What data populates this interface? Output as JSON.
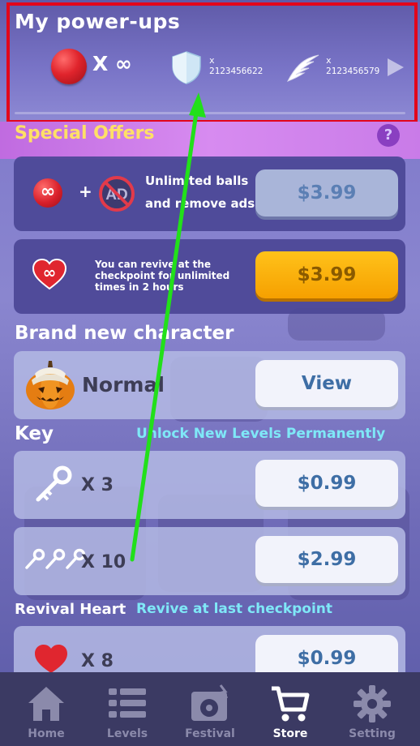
{
  "powerups": {
    "title": "My power-ups",
    "ball_count": "X ∞",
    "shield_x": "x",
    "shield_count": "2123456622",
    "wing_x": "x",
    "wing_count": "2123456579"
  },
  "offers": {
    "title": "Special Offers",
    "help": "?",
    "plus": "+",
    "bundle_text_1": "Unlimited balls",
    "bundle_text_2": "and remove ads",
    "bundle_price": "$3.99",
    "revive_text_1": "You can revive at the",
    "revive_text_2": "checkpoint for unlimited",
    "revive_text_3": "times in 2 hours",
    "revive_price": "$3.99"
  },
  "character": {
    "title": "Brand new character",
    "name": "Normal",
    "button": "View"
  },
  "key": {
    "title": "Key",
    "subtitle": "Unlock New Levels Permanently",
    "items": [
      {
        "qty": "X 3",
        "price": "$0.99"
      },
      {
        "qty": "X 10",
        "price": "$2.99"
      }
    ]
  },
  "revival": {
    "title": "Revival Heart",
    "subtitle": "Revive at last checkpoint",
    "items": [
      {
        "qty": "X 8",
        "price": "$0.99"
      }
    ]
  },
  "tabs": [
    {
      "label": "Home",
      "icon": "home-icon"
    },
    {
      "label": "Levels",
      "icon": "list-icon"
    },
    {
      "label": "Festival",
      "icon": "festival-icon"
    },
    {
      "label": "Store",
      "icon": "cart-icon"
    },
    {
      "label": "Setting",
      "icon": "gear-icon"
    }
  ],
  "colors": {
    "highlight_frame": "#e3061b",
    "annotation_arrow": "#22e01a",
    "offers_title": "#ffe066",
    "subtitle": "#7fe8f7",
    "gold_button": "#f6a000"
  }
}
